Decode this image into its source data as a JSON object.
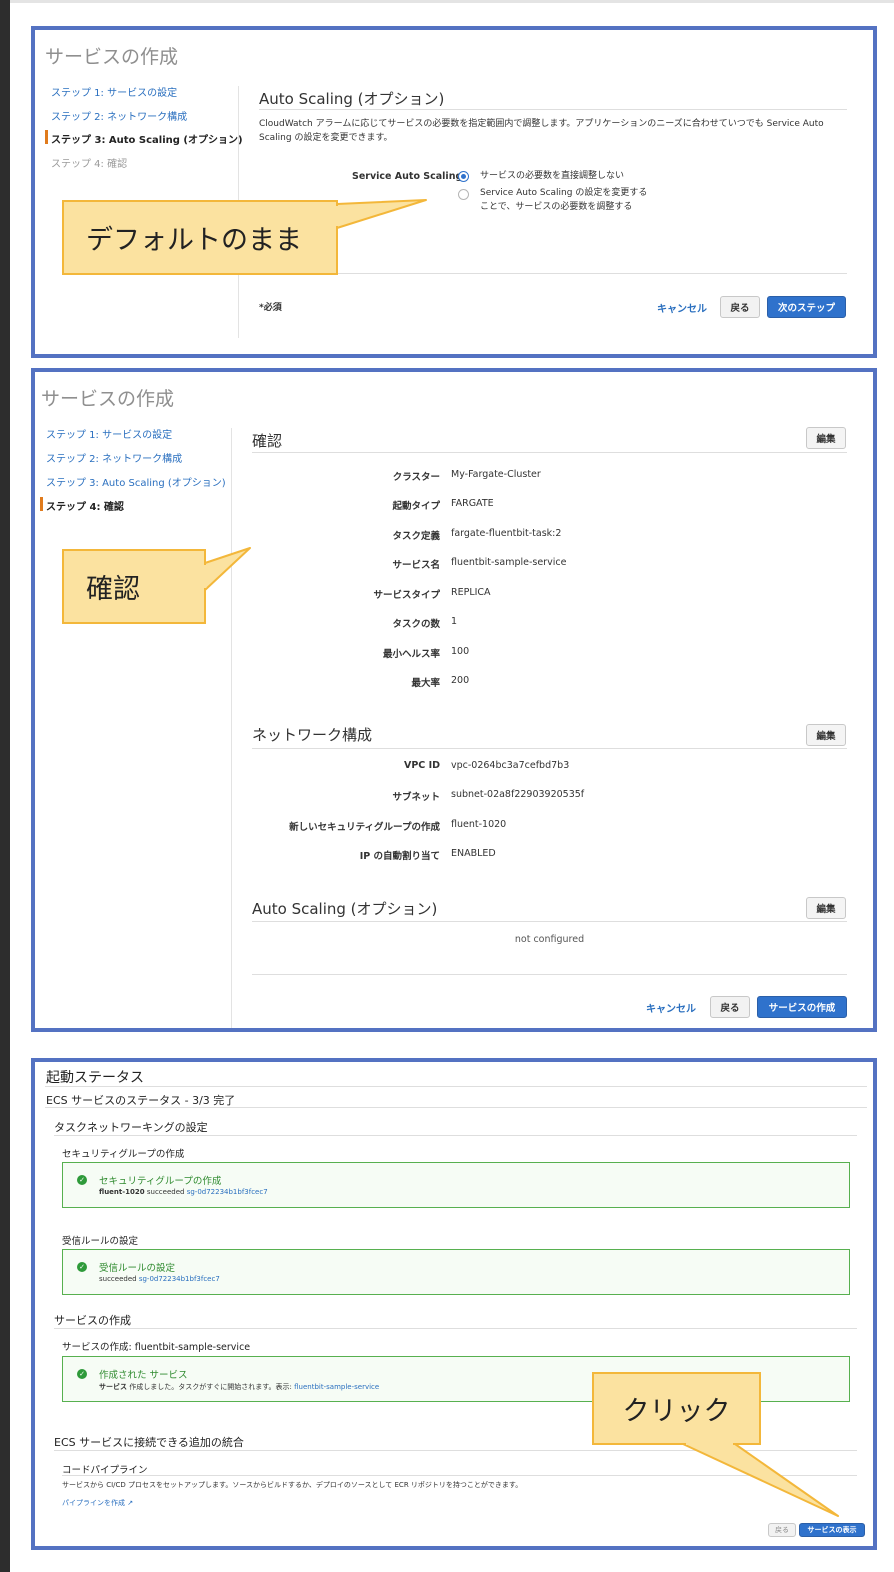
{
  "panel1": {
    "title": "サービスの作成",
    "steps": [
      {
        "label": "ステップ 1: サービスの設定"
      },
      {
        "label": "ステップ 2: ネットワーク構成"
      },
      {
        "label": "ステップ 3: Auto Scaling (オプション)"
      },
      {
        "label": "ステップ 4: 確認"
      }
    ],
    "section_title": "Auto Scaling (オプション)",
    "description": "CloudWatch アラームに応じてサービスの必要数を指定範囲内で調整します。アプリケーションのニーズに合わせていつでも Service Auto Scaling の設定を変更できます。",
    "field_label": "Service Auto Scaling",
    "radio_options": [
      {
        "label": "サービスの必要数を直接調整しない",
        "selected": true
      },
      {
        "label": "Service Auto Scaling の設定を変更することで、サービスの必要数を調整する",
        "selected": false
      }
    ],
    "required_note": "*必須",
    "cancel_label": "キャンセル",
    "back_label": "戻る",
    "next_label": "次のステップ",
    "callout": "デフォルトのまま"
  },
  "panel2": {
    "title": "サービスの作成",
    "steps": [
      {
        "label": "ステップ 1: サービスの設定"
      },
      {
        "label": "ステップ 2: ネットワーク構成"
      },
      {
        "label": "ステップ 3: Auto Scaling (オプション)"
      },
      {
        "label": "ステップ 4: 確認"
      }
    ],
    "review_title": "確認",
    "edit_label": "編集",
    "review_rows": [
      {
        "label": "クラスター",
        "value": "My-Fargate-Cluster"
      },
      {
        "label": "起動タイプ",
        "value": "FARGATE"
      },
      {
        "label": "タスク定義",
        "value": "fargate-fluentbit-task:2"
      },
      {
        "label": "サービス名",
        "value": "fluentbit-sample-service"
      },
      {
        "label": "サービスタイプ",
        "value": "REPLICA"
      },
      {
        "label": "タスクの数",
        "value": "1"
      },
      {
        "label": "最小ヘルス率",
        "value": "100"
      },
      {
        "label": "最大率",
        "value": "200"
      }
    ],
    "network_title": "ネットワーク構成",
    "network_rows": [
      {
        "label": "VPC ID",
        "value": "vpc-0264bc3a7cefbd7b3"
      },
      {
        "label": "サブネット",
        "value": "subnet-02a8f22903920535f"
      },
      {
        "label": "新しいセキュリティグループの作成",
        "value": "fluent-1020"
      },
      {
        "label": "IP の自動割り当て",
        "value": "ENABLED"
      }
    ],
    "autoscaling_title": "Auto Scaling (オプション)",
    "autoscaling_value": "not configured",
    "cancel_label": "キャンセル",
    "back_label": "戻る",
    "create_label": "サービスの作成",
    "callout": "確認"
  },
  "panel3": {
    "title": "起動ステータス",
    "status_line": "ECS サービスのステータス - 3/3 完了",
    "task_net_title": "タスクネットワーキングの設定",
    "sg_heading": "セキュリティグループの作成",
    "sg_box_title": "セキュリティグループの作成",
    "sg_box_name": "fluent-1020",
    "sg_box_status": "succeeded",
    "sg_box_link": "sg-0d72234b1bf3fcec7",
    "inbound_heading": "受信ルールの設定",
    "inbound_box_title": "受信ルールの設定",
    "inbound_box_status": "succeeded",
    "inbound_box_link": "sg-0d72234b1bf3fcec7",
    "service_section_title": "サービスの作成",
    "service_heading": "サービスの作成: fluentbit-sample-service",
    "service_box_title": "作成された サービス",
    "service_box_bold": "サービス",
    "service_box_text": "作成しました。タスクがすぐに開始されます。表示:",
    "service_box_link": "fluentbit-sample-service",
    "integration_title": "ECS サービスに接続できる追加の統合",
    "pipeline_heading": "コードパイプライン",
    "pipeline_text": "サービスから CI/CD プロセスをセットアップします。ソースからビルドするか、デプロイのソースとして ECR リポジトリを持つことができます。",
    "pipeline_link": "パイプラインを作成",
    "back_label": "戻る",
    "view_label": "サービスの表示",
    "callout": "クリック"
  },
  "colors": {
    "panel_border": "#5472c2",
    "primary": "#2f72cc",
    "link": "#2a6fbf",
    "success": "#2e8a2e",
    "callout_fill": "#fbe2a0",
    "callout_border": "#f3b73a"
  }
}
